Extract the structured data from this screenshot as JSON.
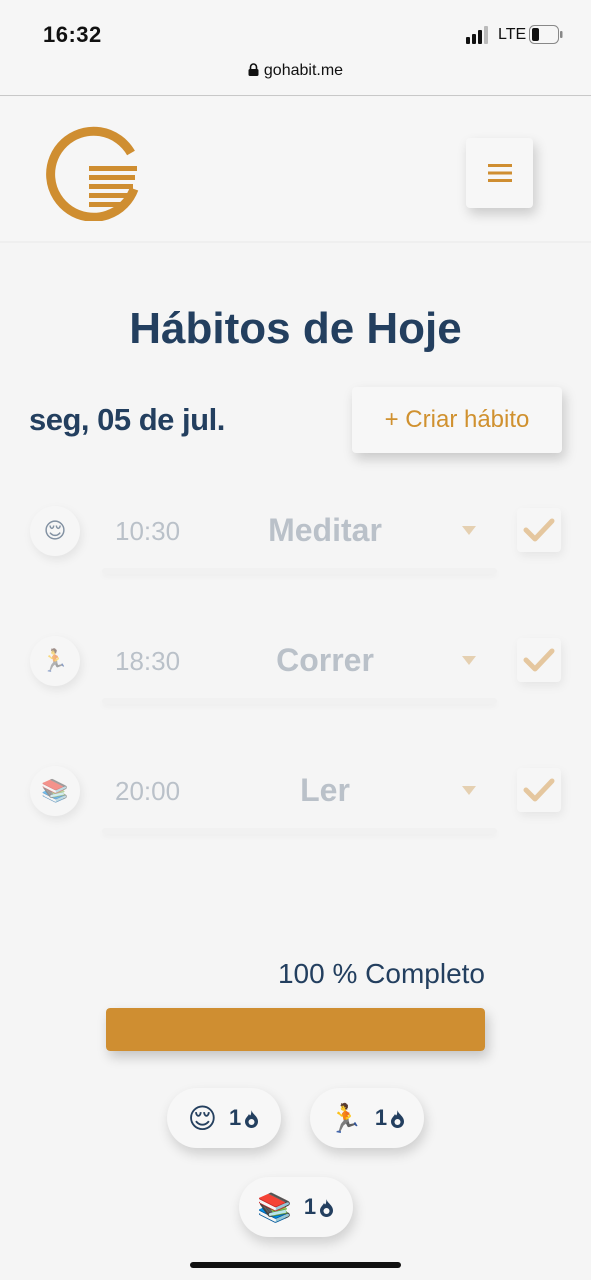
{
  "status_bar": {
    "time": "16:32",
    "network": "LTE",
    "url": "gohabit.me"
  },
  "header": {
    "logo_icon": "gohabit-logo",
    "menu_icon": "hamburger-icon"
  },
  "page": {
    "title": "Hábitos de Hoje",
    "date": "seg, 05 de jul.",
    "create_label": "+ Criar hábito"
  },
  "habits": [
    {
      "emoji": "😌",
      "time": "10:30",
      "name": "Meditar"
    },
    {
      "emoji": "🏃",
      "time": "18:30",
      "name": "Correr"
    },
    {
      "emoji": "📚",
      "time": "20:00",
      "name": "Ler"
    }
  ],
  "progress": {
    "label": "100 % Completo",
    "percent": 100
  },
  "streaks": [
    {
      "emoji": "😌",
      "count": "1"
    },
    {
      "emoji": "🏃",
      "count": "1"
    },
    {
      "emoji": "📚",
      "count": "1"
    }
  ],
  "colors": {
    "accent": "#cf8e31",
    "title": "#233f5f",
    "background": "#f5f5f5"
  }
}
